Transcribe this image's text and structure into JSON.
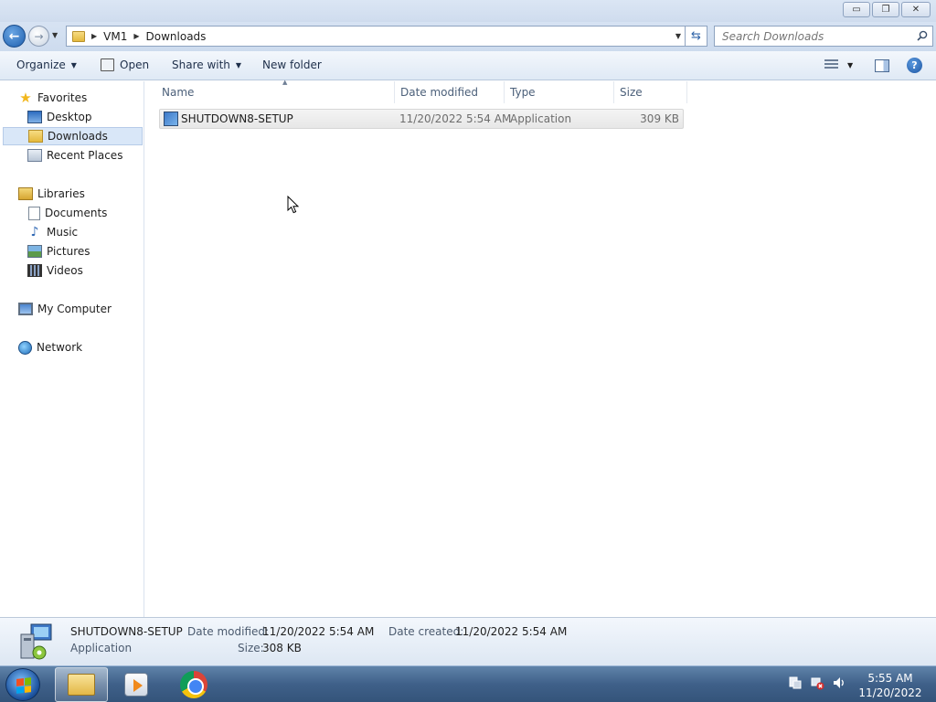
{
  "window": {
    "controls": {
      "minimize": "▭",
      "restore": "❐",
      "close": "✕"
    }
  },
  "nav": {
    "back_icon": "back-arrow-icon",
    "forward_icon": "forward-arrow-icon"
  },
  "address": {
    "crumbs": [
      "VM1",
      "Downloads"
    ]
  },
  "search": {
    "placeholder": "Search Downloads"
  },
  "toolbar": {
    "organize": "Organize",
    "open": "Open",
    "share_with": "Share with",
    "new_folder": "New folder"
  },
  "sidebar": {
    "favorites": {
      "label": "Favorites",
      "items": [
        "Desktop",
        "Downloads",
        "Recent Places"
      ],
      "selected": "Downloads"
    },
    "libraries": {
      "label": "Libraries",
      "items": [
        "Documents",
        "Music",
        "Pictures",
        "Videos"
      ]
    },
    "computer": "My Computer",
    "network": "Network"
  },
  "columns": {
    "name": "Name",
    "date_modified": "Date modified",
    "type": "Type",
    "size": "Size"
  },
  "files": [
    {
      "name": "SHUTDOWN8-SETUP",
      "date_modified": "11/20/2022 5:54 AM",
      "type": "Application",
      "size": "309 KB"
    }
  ],
  "details": {
    "name": "SHUTDOWN8-SETUP",
    "type": "Application",
    "date_modified_label": "Date modified:",
    "date_modified": "11/20/2022 5:54 AM",
    "date_created_label": "Date created:",
    "date_created": "11/20/2022 5:54 AM",
    "size_label": "Size:",
    "size": "308 KB"
  },
  "taskbar": {
    "time": "5:55 AM",
    "date": "11/20/2022"
  },
  "colors": {
    "accent": "#1f5fae",
    "selection": "#d9e7f8",
    "taskbar": "#3f6089"
  }
}
